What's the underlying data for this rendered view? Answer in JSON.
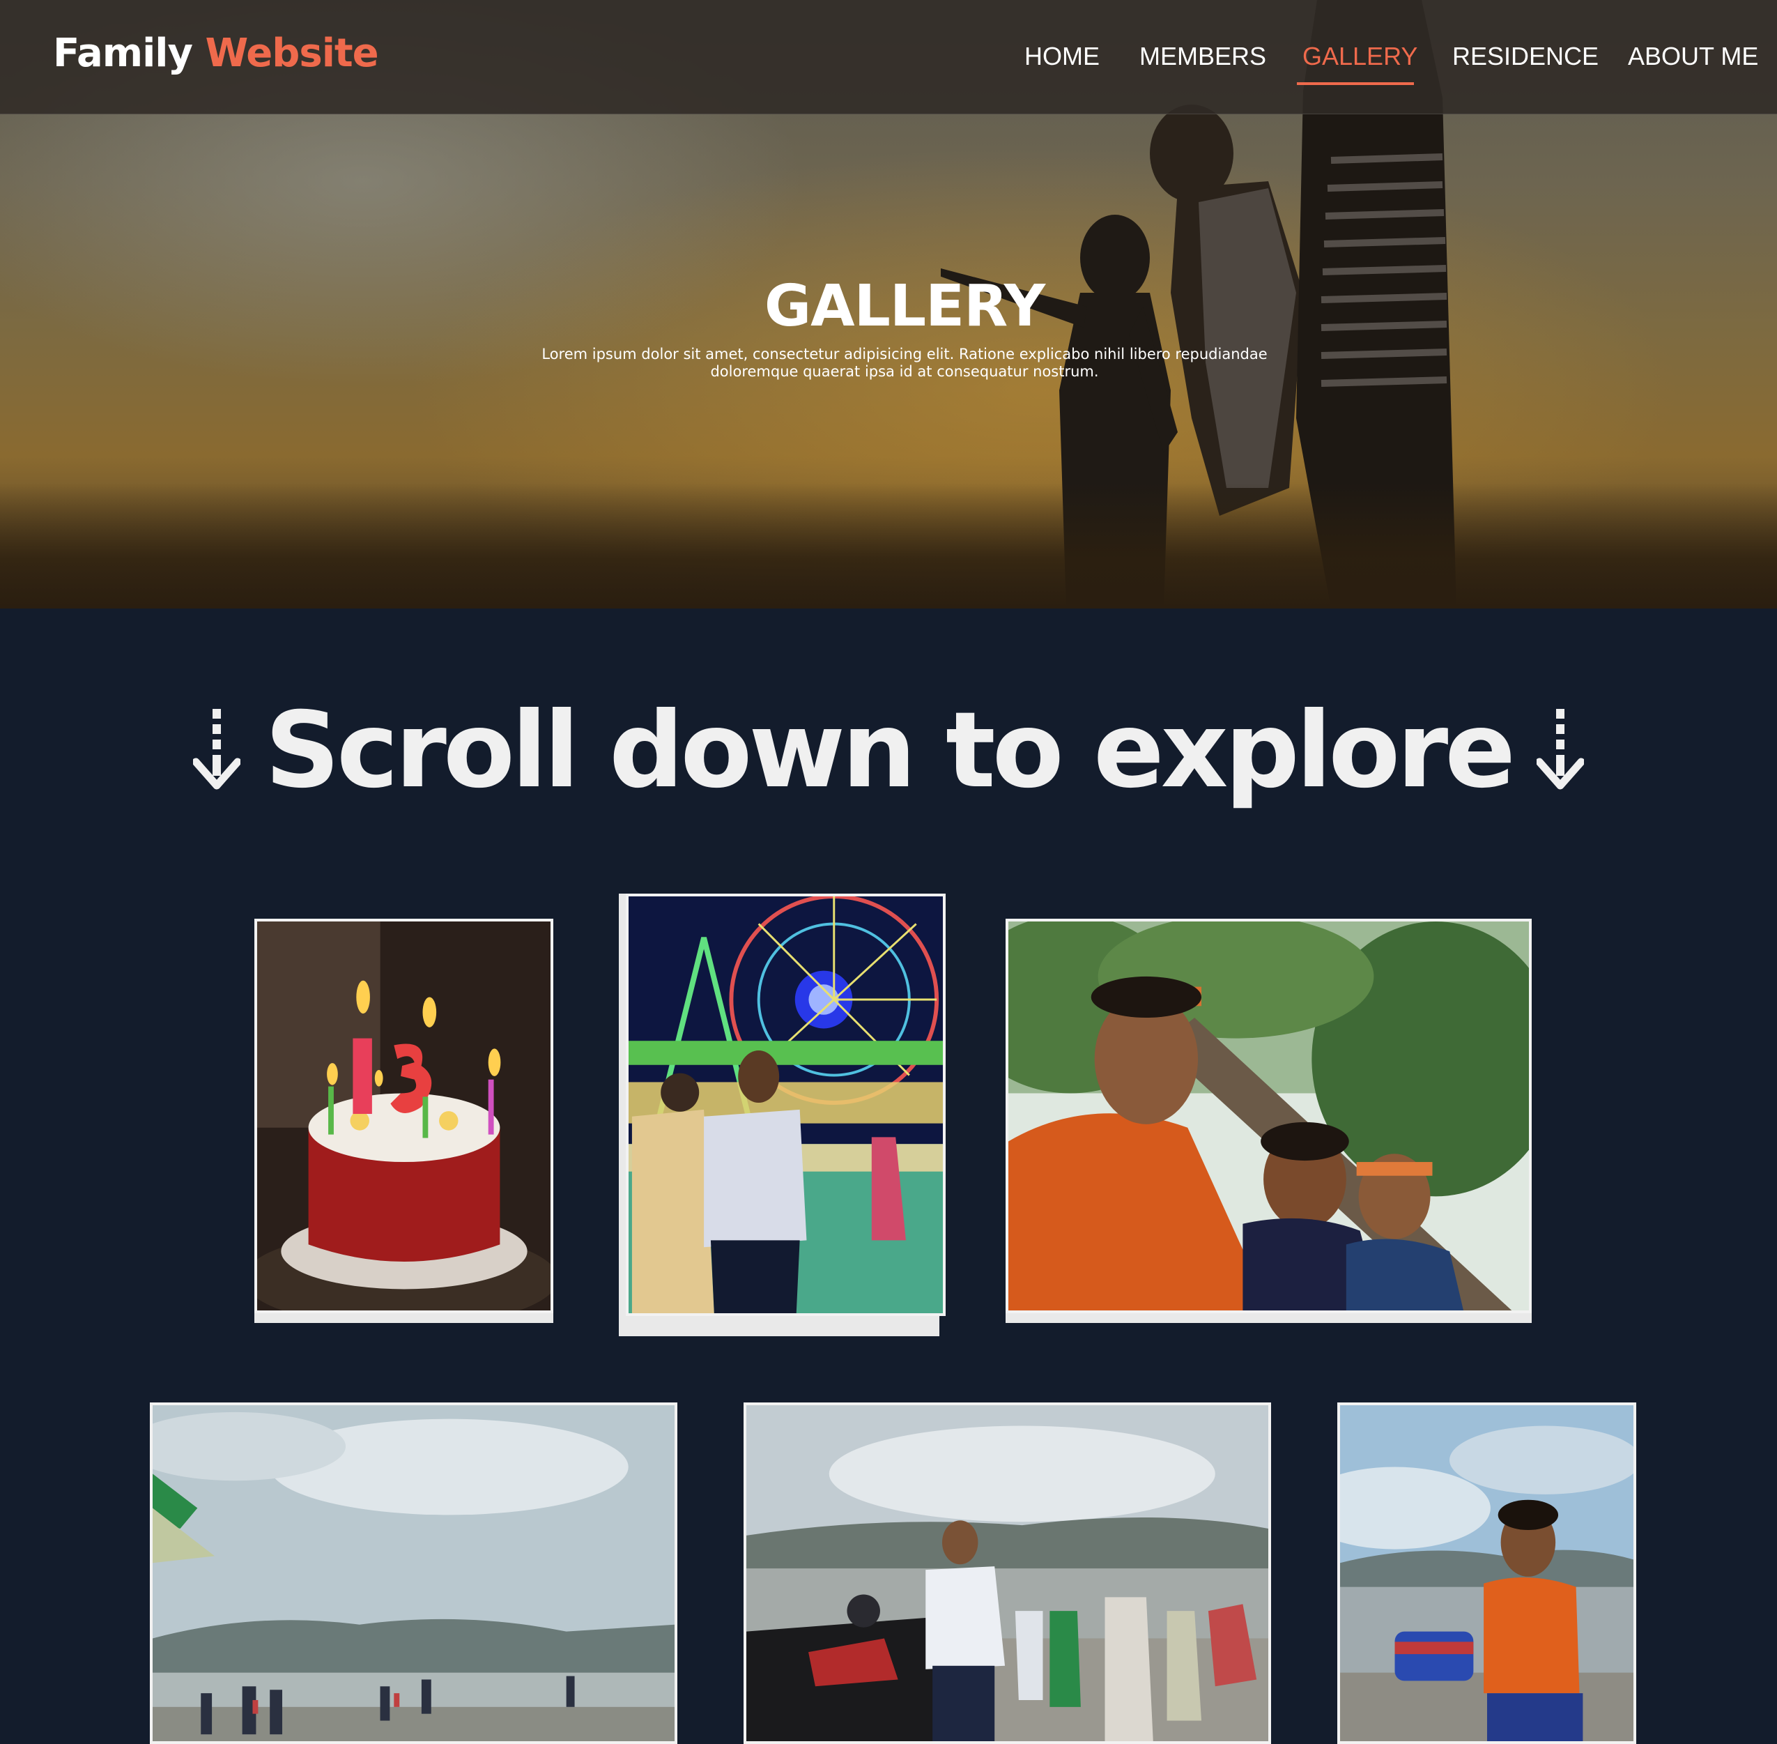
{
  "navbar": {
    "brand_first": "Family",
    "brand_second": "Website",
    "items": [
      {
        "label": "HOME"
      },
      {
        "label": "MEMBERS"
      },
      {
        "label": "GALLERY",
        "active": true
      },
      {
        "label": "RESIDENCE"
      },
      {
        "label": "ABOUT ME"
      }
    ]
  },
  "hero": {
    "title": "GALLERY",
    "subtitle_line1": "Lorem ipsum dolor sit amet, consectetur adipisicing elit. Ratione explicabo nihil libero repudiandae",
    "subtitle_line2": "doloremque quaerat ipsa id at consequatur nostrum."
  },
  "section": {
    "heading": "Scroll down to explore",
    "left_icon": "dashed-arrow-down-icon",
    "right_icon": "dashed-arrow-down-icon"
  },
  "colors": {
    "accent": "#ef6a4c",
    "page_background": "#131c2c",
    "text": "#ffffff"
  },
  "gallery": {
    "photos": [
      {
        "name": "birthday-cake-photo"
      },
      {
        "name": "night-fair-photo"
      },
      {
        "name": "forest-selfie-photo"
      },
      {
        "name": "riverbank-crowd-photo"
      },
      {
        "name": "riverside-man-photo"
      },
      {
        "name": "riverside-boy-photo"
      }
    ]
  }
}
